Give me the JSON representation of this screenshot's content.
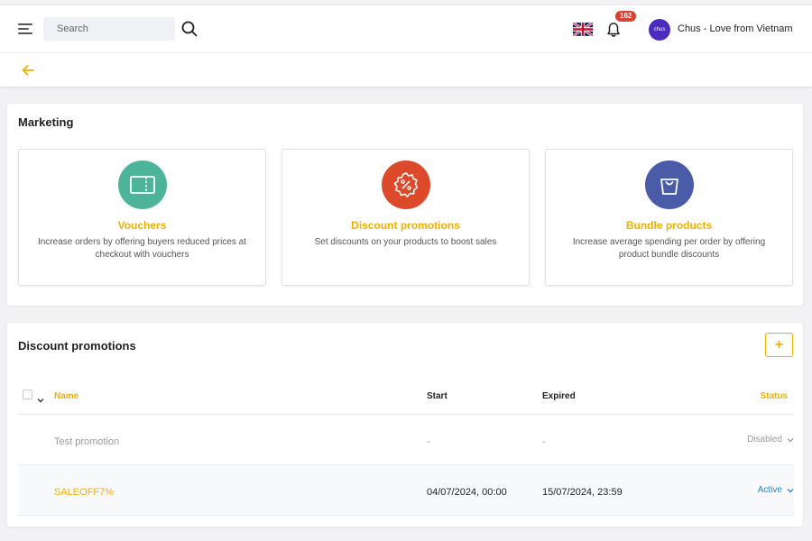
{
  "header": {
    "search_placeholder": "Search",
    "notification_count": "162",
    "avatar_text": "chus",
    "user_name": "Chus - Love from Vietnam"
  },
  "marketing": {
    "title": "Marketing",
    "tiles": [
      {
        "title": "Vouchers",
        "description": "Increase orders by offering buyers reduced prices at checkout with vouchers",
        "icon": "voucher-icon",
        "color": "#4db49a"
      },
      {
        "title": "Discount promotions",
        "description": "Set discounts on your products to boost sales",
        "icon": "discount-badge-icon",
        "color": "#dc4a2b"
      },
      {
        "title": "Bundle products",
        "description": "Increase average spending per order by offering product bundle discounts",
        "icon": "shopping-bag-icon",
        "color": "#4a5ca8"
      }
    ]
  },
  "discounts": {
    "title": "Discount promotions",
    "add_label": "+",
    "columns": {
      "name": "Name",
      "start": "Start",
      "expired": "Expired",
      "status": "Status"
    },
    "rows": [
      {
        "name": "Test promotion",
        "start": "-",
        "expired": "-",
        "status": "Disabled"
      },
      {
        "name": "SALEOFF7%",
        "start": "04/07/2024, 00:00",
        "expired": "15/07/2024, 23:59",
        "status": "Active"
      }
    ]
  },
  "colors": {
    "accent": "#f0b100",
    "active_status": "#1e88c8",
    "disabled_status": "#9a9a9a"
  }
}
